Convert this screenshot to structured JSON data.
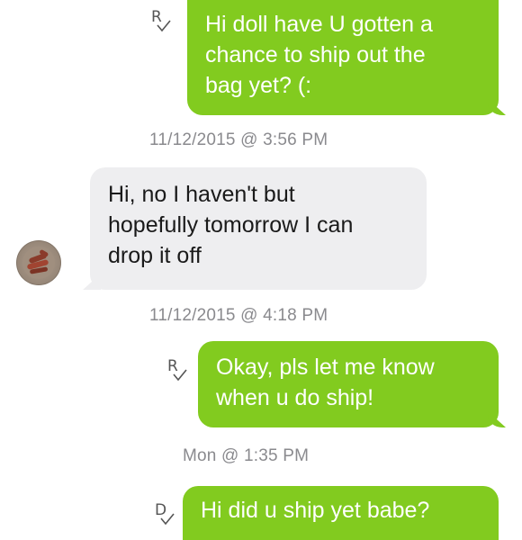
{
  "conversation": {
    "messages": [
      {
        "direction": "outgoing",
        "status_letter": "R",
        "text": "Hi doll have U gotten a\nchance to ship out the\nbag yet? (:"
      },
      {
        "direction": "incoming",
        "text": "Hi, no I haven't but\nhopefully tomorrow I can\ndrop it off"
      },
      {
        "direction": "outgoing",
        "status_letter": "R",
        "text": "Okay, pls let me know\nwhen u do ship!"
      },
      {
        "direction": "outgoing",
        "status_letter": "D",
        "text": "Hi did u ship yet babe?"
      }
    ],
    "timestamps": [
      "11/12/2015 @ 3:56 PM",
      "11/12/2015 @ 4:18 PM",
      "Mon @ 1:35 PM"
    ]
  },
  "colors": {
    "outgoing_bubble": "#82cb1f",
    "incoming_bubble": "#eeeef0",
    "timestamp_text": "#8a8a8e"
  },
  "icons": {
    "read_receipt": "checkmark-icon",
    "avatar": "user-avatar"
  }
}
